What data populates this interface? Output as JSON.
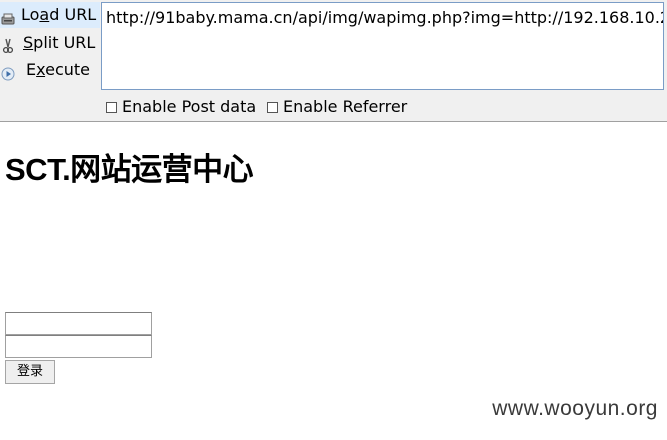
{
  "hackbar": {
    "buttons": {
      "load_url": {
        "label_pre": "Lo",
        "label_key": "a",
        "label_post": "d URL",
        "icon": "load-url-icon"
      },
      "split_url": {
        "label_key": "S",
        "label_post": "plit URL",
        "icon": "scissors-icon"
      },
      "execute": {
        "label_pre": "E",
        "label_key": "x",
        "label_post": "ecute",
        "icon": "play-icon"
      }
    },
    "url_value": "http://91baby.mama.cn/api/img/wapimg.php?img=http://192.168.10.2",
    "options": {
      "post_data": {
        "label": "Enable Post data",
        "checked": false
      },
      "referrer": {
        "label": "Enable Referrer",
        "checked": false
      }
    }
  },
  "page": {
    "title": "SCT.网站运营中心",
    "username_value": "",
    "password_value": "",
    "login_label": "登录"
  },
  "watermark": "www.wooyun.org"
}
